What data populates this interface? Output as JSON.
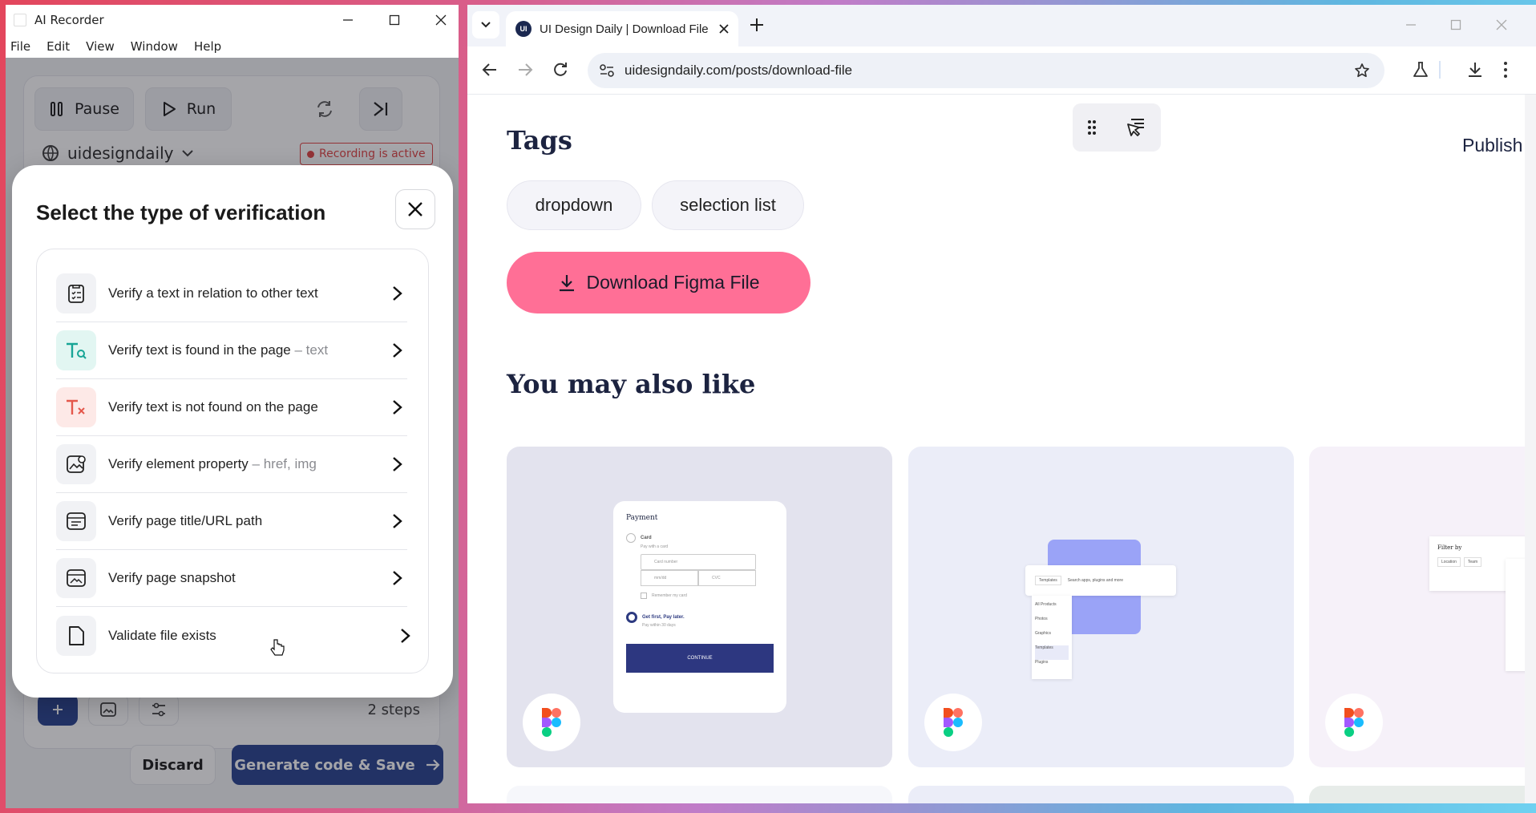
{
  "recorder": {
    "title": "AI Recorder",
    "menu": [
      "File",
      "Edit",
      "View",
      "Window",
      "Help"
    ],
    "pause_label": "Pause",
    "run_label": "Run",
    "site_label": "uidesigndaily",
    "recording_status": "Recording is active",
    "steps_label": "2 steps",
    "discard_label": "Discard",
    "generate_label": "Generate code & Save"
  },
  "modal": {
    "title": "Select the type of verification",
    "options": [
      {
        "label": "Verify a text in relation to other text",
        "hint": "",
        "icon": "checklist-icon"
      },
      {
        "label": "Verify text is found in the page",
        "hint": "– text",
        "icon": "text-search-icon"
      },
      {
        "label": "Verify text is not found on the page",
        "hint": "",
        "icon": "text-remove-icon"
      },
      {
        "label": "Verify element property",
        "hint": "– href, img",
        "icon": "image-edit-icon"
      },
      {
        "label": "Verify page title/URL path",
        "hint": "",
        "icon": "browser-window-icon"
      },
      {
        "label": "Verify page snapshot",
        "hint": "",
        "icon": "snapshot-icon"
      },
      {
        "label": "Validate file exists",
        "hint": "",
        "icon": "file-icon"
      }
    ]
  },
  "browser": {
    "tab_title": "UI Design Daily | Download File",
    "favicon_text": "UI",
    "url": "uidesigndaily.com/posts/download-file"
  },
  "page": {
    "tags_heading": "Tags",
    "tags": [
      "dropdown",
      "selection list"
    ],
    "publish_label": "Publish",
    "download_label": "Download Figma File",
    "related_heading": "You may also like",
    "card1": {
      "title": "Payment",
      "card": "Card",
      "pay_with": "Pay with a card",
      "card_number": "Card number",
      "mmyy": "mm/dd",
      "cvc": "CVC",
      "remember": "Remember my card",
      "later": "Get first, Pay later.",
      "later_sub": "Pay within 30 days",
      "continue": "CONTINUE"
    },
    "card2": {
      "templates": "Templates",
      "search": "Search apps, plugins and more",
      "items": [
        "All Products",
        "Photos",
        "Graphics",
        "Templates",
        "Plugins"
      ]
    },
    "card3": {
      "filter": "Filter by",
      "location": "Location",
      "team": "Team"
    }
  },
  "colors": {
    "accent": "#1e3a8a",
    "download_btn": "#ff6f96",
    "recording": "#e03b3b"
  }
}
